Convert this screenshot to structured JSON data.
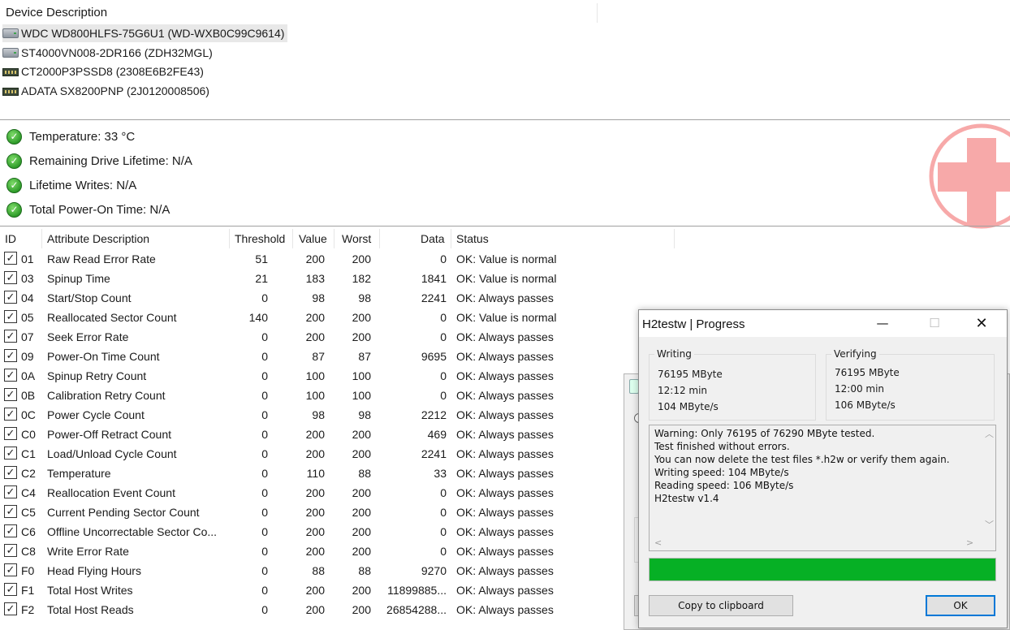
{
  "device_list": {
    "header": "Device Description",
    "devices": [
      {
        "label": "WDC WD800HLFS-75G6U1 (WD-WXB0C99C9614)",
        "type": "hdd",
        "selected": true
      },
      {
        "label": "ST4000VN008-2DR166 (ZDH32MGL)",
        "type": "hdd",
        "selected": false
      },
      {
        "label": "CT2000P3PSSD8 (2308E6B2FE43)",
        "type": "ssd",
        "selected": false
      },
      {
        "label": "ADATA SX8200PNP (2J0120008506)",
        "type": "ssd",
        "selected": false
      }
    ]
  },
  "health": {
    "items": [
      {
        "label": "Temperature: 33 °C",
        "icon": "check-icon"
      },
      {
        "label": "Remaining Drive Lifetime: N/A",
        "icon": "check-icon"
      },
      {
        "label": "Lifetime Writes: N/A",
        "icon": "check-icon"
      },
      {
        "label": "Total Power-On Time: N/A",
        "icon": "check-icon"
      }
    ],
    "logo_color": "#f7a9a9"
  },
  "attributes": {
    "columns": {
      "id": "ID",
      "description": "Attribute Description",
      "threshold": "Threshold",
      "value": "Value",
      "worst": "Worst",
      "data": "Data",
      "status": "Status"
    },
    "rows": [
      {
        "id": "01",
        "description": "Raw Read Error Rate",
        "threshold": "51",
        "value": "200",
        "worst": "200",
        "data": "0",
        "status": "OK: Value is normal",
        "checked": true
      },
      {
        "id": "03",
        "description": "Spinup Time",
        "threshold": "21",
        "value": "183",
        "worst": "182",
        "data": "1841",
        "status": "OK: Value is normal",
        "checked": true
      },
      {
        "id": "04",
        "description": "Start/Stop Count",
        "threshold": "0",
        "value": "98",
        "worst": "98",
        "data": "2241",
        "status": "OK: Always passes",
        "checked": true
      },
      {
        "id": "05",
        "description": "Reallocated Sector Count",
        "threshold": "140",
        "value": "200",
        "worst": "200",
        "data": "0",
        "status": "OK: Value is normal",
        "checked": true
      },
      {
        "id": "07",
        "description": "Seek Error Rate",
        "threshold": "0",
        "value": "200",
        "worst": "200",
        "data": "0",
        "status": "OK: Always passes",
        "checked": true
      },
      {
        "id": "09",
        "description": "Power-On Time Count",
        "threshold": "0",
        "value": "87",
        "worst": "87",
        "data": "9695",
        "status": "OK: Always passes",
        "checked": true
      },
      {
        "id": "0A",
        "description": "Spinup Retry Count",
        "threshold": "0",
        "value": "100",
        "worst": "100",
        "data": "0",
        "status": "OK: Always passes",
        "checked": true
      },
      {
        "id": "0B",
        "description": "Calibration Retry Count",
        "threshold": "0",
        "value": "100",
        "worst": "100",
        "data": "0",
        "status": "OK: Always passes",
        "checked": true
      },
      {
        "id": "0C",
        "description": "Power Cycle Count",
        "threshold": "0",
        "value": "98",
        "worst": "98",
        "data": "2212",
        "status": "OK: Always passes",
        "checked": true
      },
      {
        "id": "C0",
        "description": "Power-Off Retract Count",
        "threshold": "0",
        "value": "200",
        "worst": "200",
        "data": "469",
        "status": "OK: Always passes",
        "checked": true
      },
      {
        "id": "C1",
        "description": "Load/Unload Cycle Count",
        "threshold": "0",
        "value": "200",
        "worst": "200",
        "data": "2241",
        "status": "OK: Always passes",
        "checked": true
      },
      {
        "id": "C2",
        "description": "Temperature",
        "threshold": "0",
        "value": "110",
        "worst": "88",
        "data": "33",
        "status": "OK: Always passes",
        "checked": true
      },
      {
        "id": "C4",
        "description": "Reallocation Event Count",
        "threshold": "0",
        "value": "200",
        "worst": "200",
        "data": "0",
        "status": "OK: Always passes",
        "checked": true
      },
      {
        "id": "C5",
        "description": "Current Pending Sector Count",
        "threshold": "0",
        "value": "200",
        "worst": "200",
        "data": "0",
        "status": "OK: Always passes",
        "checked": true
      },
      {
        "id": "C6",
        "description": "Offline Uncorrectable Sector Co...",
        "threshold": "0",
        "value": "200",
        "worst": "200",
        "data": "0",
        "status": "OK: Always passes",
        "checked": true
      },
      {
        "id": "C8",
        "description": "Write Error Rate",
        "threshold": "0",
        "value": "200",
        "worst": "200",
        "data": "0",
        "status": "OK: Always passes",
        "checked": true
      },
      {
        "id": "F0",
        "description": "Head Flying Hours",
        "threshold": "0",
        "value": "88",
        "worst": "88",
        "data": "9270",
        "status": "OK: Always passes",
        "checked": true
      },
      {
        "id": "F1",
        "description": "Total Host Writes",
        "threshold": "0",
        "value": "200",
        "worst": "200",
        "data": "11899885...",
        "status": "OK: Always passes",
        "checked": true
      },
      {
        "id": "F2",
        "description": "Total Host Reads",
        "threshold": "0",
        "value": "200",
        "worst": "200",
        "data": "26854288...",
        "status": "OK: Always passes",
        "checked": true
      }
    ]
  },
  "dialog": {
    "title": "H2testw | Progress",
    "buttons": {
      "minimize": "—",
      "maximize": "☐",
      "close": "✕",
      "copy": "Copy to clipboard",
      "ok": "OK"
    },
    "writing": {
      "label": "Writing",
      "amount": "76195 MByte",
      "time": "12:12 min",
      "speed": "104 MByte/s"
    },
    "verifying": {
      "label": "Verifying",
      "amount": "76195 MByte",
      "time": "12:00 min",
      "speed": "106 MByte/s"
    },
    "log": [
      "Warning: Only 76195 of 76290 MByte tested.",
      "Test finished without errors.",
      "You can now delete the test files *.h2w or verify them again.",
      "Writing speed: 104 MByte/s",
      "Reading speed: 106 MByte/s",
      "H2testw v1.4"
    ],
    "progress_percent": 100,
    "progress_color": "#06b025"
  }
}
